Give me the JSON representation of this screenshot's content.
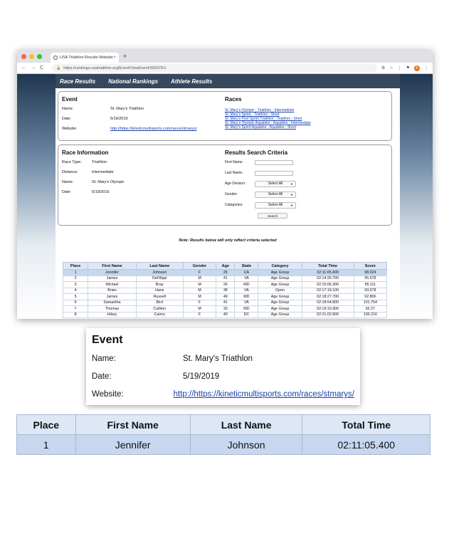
{
  "browser": {
    "tab_title": "USA Triathlon Results Website",
    "url": "https://rankings.usatriathlon.org/Event/ViewEvent/300375/1",
    "avatar_letter": "K"
  },
  "site_nav": {
    "items": [
      "Race Results",
      "National Rankings",
      "Athlete Results"
    ]
  },
  "event": {
    "heading": "Event",
    "name_label": "Name:",
    "name_value": "St. Mary's Triathlon",
    "date_label": "Date:",
    "date_value": "5/19/2019",
    "website_label": "Website:",
    "website_value": "http://https://kineticmultisports.com/races/stmarys/"
  },
  "races": {
    "heading": "Races",
    "links": [
      "St. Mary's Olympic - Triathlon - Intermediate",
      "St. Mary's Sprint - Triathlon - Short",
      "St. Mary's Pool Sprint Triathlon - Triathlon - Short",
      "St. Mary's Olympic Aquabike - Aquabike - Intermediate",
      "St. Mary's Sprint Aquabike - Aquabike - Short"
    ]
  },
  "race_info": {
    "heading": "Race Information",
    "type_label": "Race Type:",
    "type_value": "Triathlon",
    "distance_label": "Distance:",
    "distance_value": "Intermediate",
    "name_label": "Name:",
    "name_value": "St. Mary's Olympic",
    "date_label": "Date:",
    "date_value": "5/19/2019"
  },
  "criteria": {
    "heading": "Results Search Criteria",
    "first_name_label": "First Name:",
    "last_name_label": "Last Name:",
    "age_label": "Age Division:",
    "gender_label": "Gender:",
    "categories_label": "Categories:",
    "select_all": "Select All",
    "search_button": "Search"
  },
  "note": "Note: Results below will only reflect criteria selected",
  "results": {
    "headers": [
      "Place",
      "First Name",
      "Last Name",
      "Gender",
      "Age",
      "State",
      "Category",
      "Total Time",
      "Score"
    ],
    "rows": [
      [
        "1",
        "Jennifer",
        "Johnson",
        "F",
        "26",
        "CA",
        "Age Group",
        "02:11:05.400",
        "98.024"
      ],
      [
        "2",
        "James",
        "DeFilippi",
        "M",
        "41",
        "VA",
        "Age Group",
        "02:14:26.700",
        "95.578"
      ],
      [
        "3",
        "Michael",
        "Bray",
        "M",
        "26",
        "MD",
        "Age Group",
        "02:15:06.300",
        "95.111"
      ],
      [
        "4",
        "Brian",
        "Hans",
        "M",
        "38",
        "VA",
        "Open",
        "02:17:19.100",
        "93.578"
      ],
      [
        "5",
        "James",
        "Russell",
        "M",
        "49",
        "MD",
        "Age Group",
        "02:18:27.700",
        "92.806"
      ],
      [
        "6",
        "Samantha",
        "Bird",
        "F",
        "41",
        "VA",
        "Age Group",
        "02:18:54.800",
        "101.754"
      ],
      [
        "7",
        "Thomas",
        "Culliton",
        "M",
        "33",
        "MD",
        "Age Group",
        "02:19:15.900",
        "92.27"
      ],
      [
        "8",
        "Hilary",
        "Cairns",
        "F",
        "49",
        "DC",
        "Age Group",
        "02:21:02.800",
        "100.216"
      ]
    ]
  },
  "zoom_table": {
    "headers": [
      "Place",
      "First Name",
      "Last Name",
      "Total Time"
    ],
    "row": [
      "1",
      "Jennifer",
      "Johnson",
      "02:11:05.400"
    ]
  }
}
